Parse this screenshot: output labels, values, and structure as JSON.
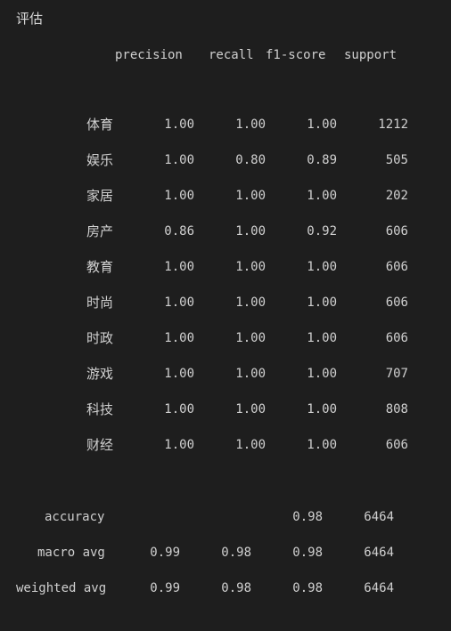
{
  "title": "评估",
  "header": {
    "precision": "precision",
    "recall": "recall",
    "f1": "f1-score",
    "support": "support"
  },
  "rows": [
    {
      "label": "体育",
      "precision": "1.00",
      "recall": "1.00",
      "f1": "1.00",
      "support": "1212"
    },
    {
      "label": "娱乐",
      "precision": "1.00",
      "recall": "0.80",
      "f1": "0.89",
      "support": "505"
    },
    {
      "label": "家居",
      "precision": "1.00",
      "recall": "1.00",
      "f1": "1.00",
      "support": "202"
    },
    {
      "label": "房产",
      "precision": "0.86",
      "recall": "1.00",
      "f1": "0.92",
      "support": "606"
    },
    {
      "label": "教育",
      "precision": "1.00",
      "recall": "1.00",
      "f1": "1.00",
      "support": "606"
    },
    {
      "label": "时尚",
      "precision": "1.00",
      "recall": "1.00",
      "f1": "1.00",
      "support": "606"
    },
    {
      "label": "时政",
      "precision": "1.00",
      "recall": "1.00",
      "f1": "1.00",
      "support": "606"
    },
    {
      "label": "游戏",
      "precision": "1.00",
      "recall": "1.00",
      "f1": "1.00",
      "support": "707"
    },
    {
      "label": "科技",
      "precision": "1.00",
      "recall": "1.00",
      "f1": "1.00",
      "support": "808"
    },
    {
      "label": "财经",
      "precision": "1.00",
      "recall": "1.00",
      "f1": "1.00",
      "support": "606"
    }
  ],
  "summary": {
    "accuracy": {
      "label": "accuracy",
      "f1": "0.98",
      "support": "6464"
    },
    "macro": {
      "label": "macro avg",
      "precision": "0.99",
      "recall": "0.98",
      "f1": "0.98",
      "support": "6464"
    },
    "weighted": {
      "label": "weighted avg",
      "precision": "0.99",
      "recall": "0.98",
      "f1": "0.98",
      "support": "6464"
    }
  }
}
